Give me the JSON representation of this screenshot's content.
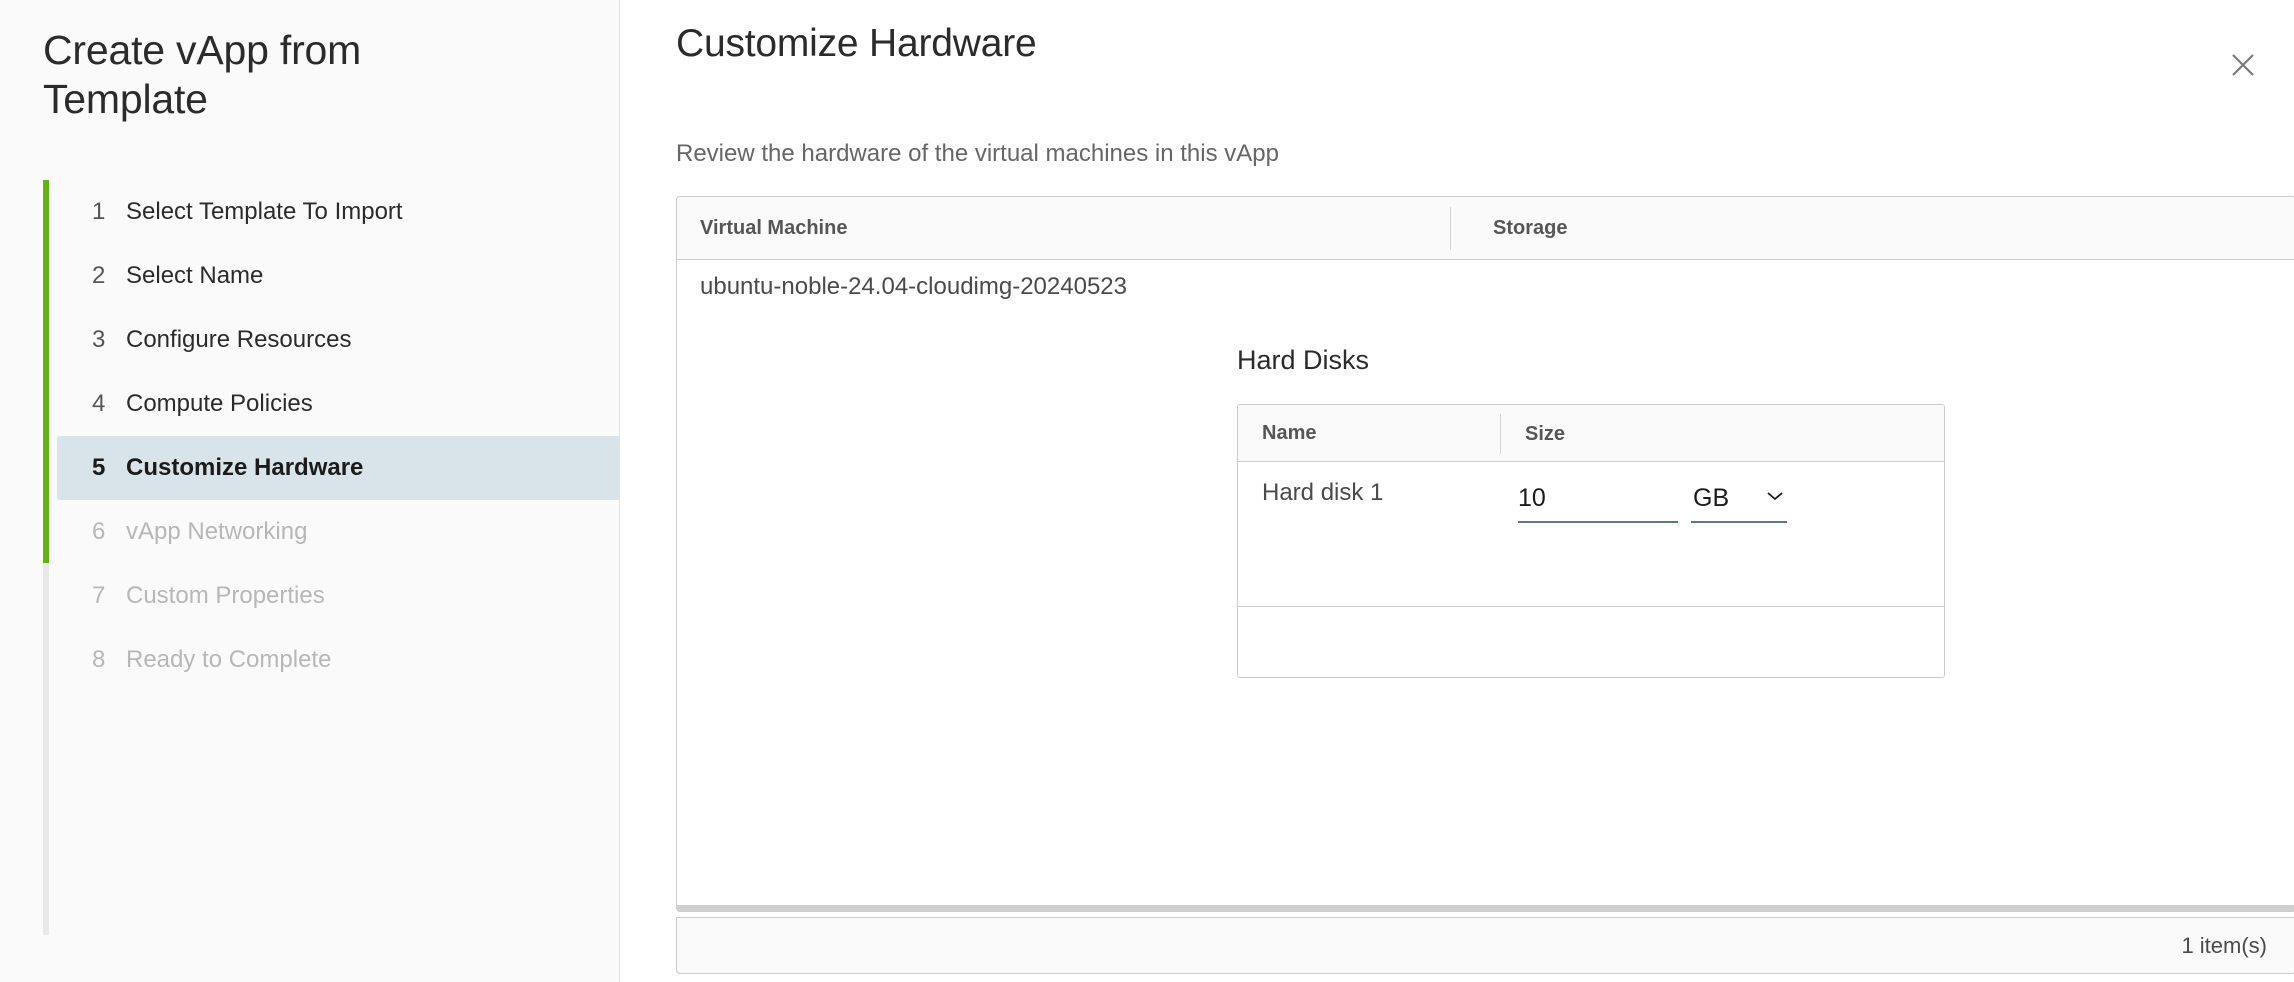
{
  "wizard": {
    "title": "Create vApp from Template",
    "accent_done_color": "#60b515",
    "accent_todo_color": "#e8e8e8",
    "current_step_bg": "#d9e4ea",
    "steps": [
      {
        "num": "1",
        "label": "Select Template To Import",
        "state": "done"
      },
      {
        "num": "2",
        "label": "Select Name",
        "state": "done"
      },
      {
        "num": "3",
        "label": "Configure Resources",
        "state": "done"
      },
      {
        "num": "4",
        "label": "Compute Policies",
        "state": "done"
      },
      {
        "num": "5",
        "label": "Customize Hardware",
        "state": "current"
      },
      {
        "num": "6",
        "label": "vApp Networking",
        "state": "disabled"
      },
      {
        "num": "7",
        "label": "Custom Properties",
        "state": "disabled"
      },
      {
        "num": "8",
        "label": "Ready to Complete",
        "state": "disabled"
      }
    ]
  },
  "panel": {
    "title": "Customize Hardware",
    "subtitle": "Review the hardware of the virtual machines in this vApp",
    "close_icon": "close-icon"
  },
  "vm_grid": {
    "columns": {
      "virtual_machine": "Virtual Machine",
      "storage": "Storage"
    },
    "rows": [
      {
        "virtual_machine": "ubuntu-noble-24.04-cloudimg-20240523"
      }
    ],
    "footer_count": "1 item(s)"
  },
  "hard_disks": {
    "heading": "Hard Disks",
    "columns": {
      "name": "Name",
      "size": "Size"
    },
    "rows": [
      {
        "name": "Hard disk 1",
        "size_value": "10",
        "size_placeholder": "Size",
        "size_unit": "GB",
        "unit_chevron_icon": "chevron-down-icon"
      }
    ]
  }
}
